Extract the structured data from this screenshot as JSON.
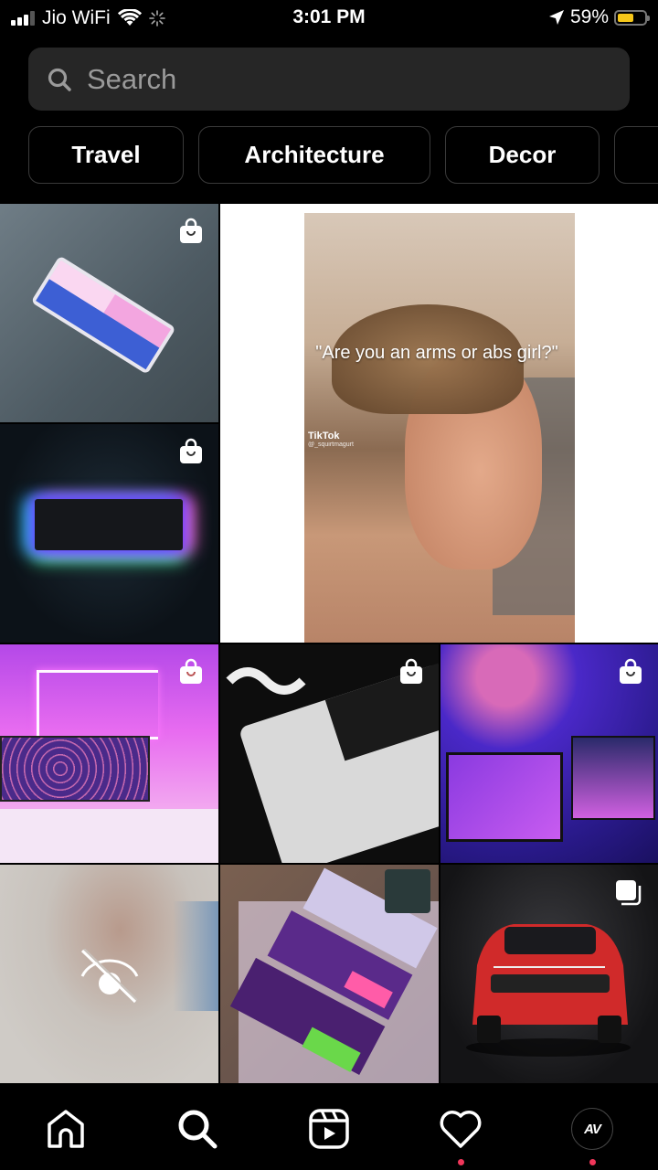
{
  "status_bar": {
    "carrier": "Jio WiFi",
    "time": "3:01 PM",
    "battery_percent": "59%",
    "battery_level": 0.59,
    "signal_bars": 3,
    "battery_color": "#f6c719"
  },
  "search": {
    "placeholder": "Search",
    "value": ""
  },
  "chips": [
    {
      "label": "Travel"
    },
    {
      "label": "Architecture"
    },
    {
      "label": "Decor"
    },
    {
      "label": ""
    }
  ],
  "grid": {
    "tiles": [
      {
        "id": "rgb-keyboard-white",
        "badge": "shopping-bag-icon"
      },
      {
        "id": "rgb-keyboard-glow",
        "badge": "shopping-bag-icon"
      },
      {
        "id": "reel-video",
        "caption": "\"Are you an arms or abs girl?\"",
        "watermark": "TikTok",
        "watermark_handle": "@_squirtmagurt"
      },
      {
        "id": "pink-desk-setup",
        "badge": "shopping-bag-icon"
      },
      {
        "id": "white-keycaps",
        "badge": "shopping-bag-icon"
      },
      {
        "id": "purple-gaming-setup",
        "badge": "shopping-bag-icon"
      },
      {
        "id": "hidden-sensitive-content",
        "badge": "eye-off-icon"
      },
      {
        "id": "colorful-keyboards",
        "badge": ""
      },
      {
        "id": "red-suv",
        "badge": "carousel-icon"
      }
    ]
  },
  "nav": {
    "items": [
      {
        "name": "home"
      },
      {
        "name": "search"
      },
      {
        "name": "reels"
      },
      {
        "name": "activity",
        "notification": true
      },
      {
        "name": "profile",
        "avatar_text": "AV",
        "notification": true
      }
    ],
    "notification_color": "#f0365a"
  }
}
